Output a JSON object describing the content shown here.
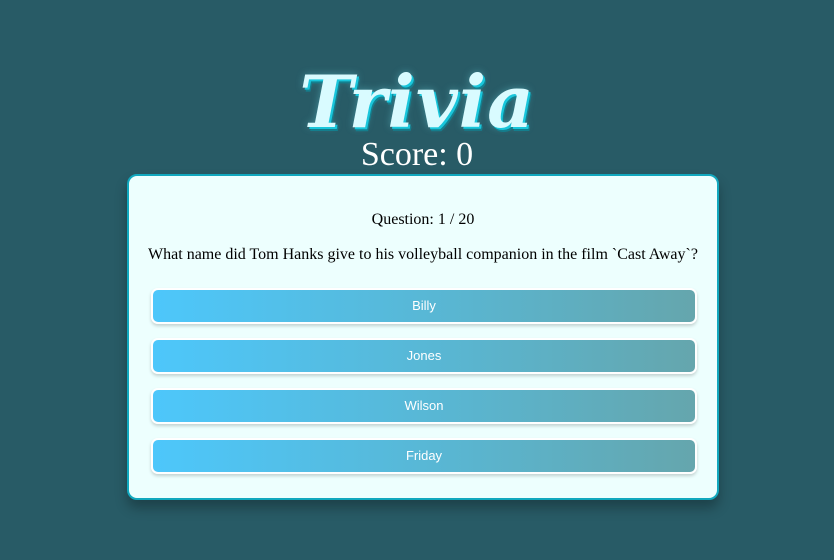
{
  "app": {
    "title": "Trivia"
  },
  "score": {
    "label": "Score: 0"
  },
  "quiz": {
    "counter": "Question: 1 / 20",
    "question": "What name did Tom Hanks give to his volleyball companion in the film `Cast Away`?",
    "answers": [
      {
        "label": "Billy"
      },
      {
        "label": "Jones"
      },
      {
        "label": "Wilson"
      },
      {
        "label": "Friday"
      }
    ]
  },
  "colors": {
    "background": "#285b66",
    "card": "#edfffe",
    "card_border": "#11a8be",
    "answer_gradient_start": "#4dc7fb",
    "answer_gradient_end": "#65a6ad"
  }
}
